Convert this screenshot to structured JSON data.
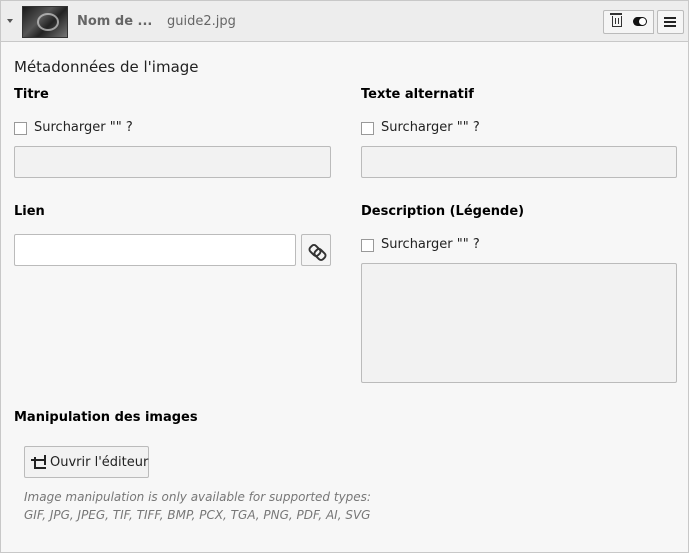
{
  "header": {
    "name_label": "Nom de ...",
    "file_name": "guide2.jpg"
  },
  "section_title": "Métadonnées de l'image",
  "fields": {
    "title": {
      "label": "Titre",
      "override_label": "Surcharger \"\" ?",
      "value": ""
    },
    "alt": {
      "label": "Texte alternatif",
      "override_label": "Surcharger \"\" ?",
      "value": ""
    },
    "link": {
      "label": "Lien",
      "value": ""
    },
    "description": {
      "label": "Description (Légende)",
      "override_label": "Surcharger \"\" ?",
      "value": ""
    }
  },
  "manipulation": {
    "label": "Manipulation des images",
    "button_label": "Ouvrir l'éditeur",
    "note_line1": "Image manipulation is only available for supported types:",
    "note_line2": "GIF, JPG, JPEG, TIF, TIFF, BMP, PCX, TGA, PNG, PDF, AI, SVG"
  },
  "icons": {
    "collapse": "caret-down-icon",
    "thumbnail": "image-thumbnail",
    "delete": "trash-icon",
    "toggle": "toggle-icon",
    "menu": "menu-icon",
    "link_browser": "chain-link-icon",
    "crop": "crop-icon"
  }
}
